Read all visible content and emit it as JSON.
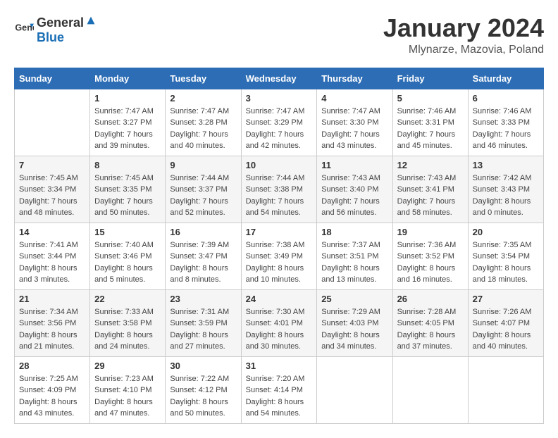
{
  "header": {
    "logo_general": "General",
    "logo_blue": "Blue",
    "title": "January 2024",
    "location": "Mlynarze, Mazovia, Poland"
  },
  "weekdays": [
    "Sunday",
    "Monday",
    "Tuesday",
    "Wednesday",
    "Thursday",
    "Friday",
    "Saturday"
  ],
  "weeks": [
    [
      {
        "day": "",
        "text": ""
      },
      {
        "day": "1",
        "text": "Sunrise: 7:47 AM\nSunset: 3:27 PM\nDaylight: 7 hours\nand 39 minutes."
      },
      {
        "day": "2",
        "text": "Sunrise: 7:47 AM\nSunset: 3:28 PM\nDaylight: 7 hours\nand 40 minutes."
      },
      {
        "day": "3",
        "text": "Sunrise: 7:47 AM\nSunset: 3:29 PM\nDaylight: 7 hours\nand 42 minutes."
      },
      {
        "day": "4",
        "text": "Sunrise: 7:47 AM\nSunset: 3:30 PM\nDaylight: 7 hours\nand 43 minutes."
      },
      {
        "day": "5",
        "text": "Sunrise: 7:46 AM\nSunset: 3:31 PM\nDaylight: 7 hours\nand 45 minutes."
      },
      {
        "day": "6",
        "text": "Sunrise: 7:46 AM\nSunset: 3:33 PM\nDaylight: 7 hours\nand 46 minutes."
      }
    ],
    [
      {
        "day": "7",
        "text": "Sunrise: 7:45 AM\nSunset: 3:34 PM\nDaylight: 7 hours\nand 48 minutes."
      },
      {
        "day": "8",
        "text": "Sunrise: 7:45 AM\nSunset: 3:35 PM\nDaylight: 7 hours\nand 50 minutes."
      },
      {
        "day": "9",
        "text": "Sunrise: 7:44 AM\nSunset: 3:37 PM\nDaylight: 7 hours\nand 52 minutes."
      },
      {
        "day": "10",
        "text": "Sunrise: 7:44 AM\nSunset: 3:38 PM\nDaylight: 7 hours\nand 54 minutes."
      },
      {
        "day": "11",
        "text": "Sunrise: 7:43 AM\nSunset: 3:40 PM\nDaylight: 7 hours\nand 56 minutes."
      },
      {
        "day": "12",
        "text": "Sunrise: 7:43 AM\nSunset: 3:41 PM\nDaylight: 7 hours\nand 58 minutes."
      },
      {
        "day": "13",
        "text": "Sunrise: 7:42 AM\nSunset: 3:43 PM\nDaylight: 8 hours\nand 0 minutes."
      }
    ],
    [
      {
        "day": "14",
        "text": "Sunrise: 7:41 AM\nSunset: 3:44 PM\nDaylight: 8 hours\nand 3 minutes."
      },
      {
        "day": "15",
        "text": "Sunrise: 7:40 AM\nSunset: 3:46 PM\nDaylight: 8 hours\nand 5 minutes."
      },
      {
        "day": "16",
        "text": "Sunrise: 7:39 AM\nSunset: 3:47 PM\nDaylight: 8 hours\nand 8 minutes."
      },
      {
        "day": "17",
        "text": "Sunrise: 7:38 AM\nSunset: 3:49 PM\nDaylight: 8 hours\nand 10 minutes."
      },
      {
        "day": "18",
        "text": "Sunrise: 7:37 AM\nSunset: 3:51 PM\nDaylight: 8 hours\nand 13 minutes."
      },
      {
        "day": "19",
        "text": "Sunrise: 7:36 AM\nSunset: 3:52 PM\nDaylight: 8 hours\nand 16 minutes."
      },
      {
        "day": "20",
        "text": "Sunrise: 7:35 AM\nSunset: 3:54 PM\nDaylight: 8 hours\nand 18 minutes."
      }
    ],
    [
      {
        "day": "21",
        "text": "Sunrise: 7:34 AM\nSunset: 3:56 PM\nDaylight: 8 hours\nand 21 minutes."
      },
      {
        "day": "22",
        "text": "Sunrise: 7:33 AM\nSunset: 3:58 PM\nDaylight: 8 hours\nand 24 minutes."
      },
      {
        "day": "23",
        "text": "Sunrise: 7:31 AM\nSunset: 3:59 PM\nDaylight: 8 hours\nand 27 minutes."
      },
      {
        "day": "24",
        "text": "Sunrise: 7:30 AM\nSunset: 4:01 PM\nDaylight: 8 hours\nand 30 minutes."
      },
      {
        "day": "25",
        "text": "Sunrise: 7:29 AM\nSunset: 4:03 PM\nDaylight: 8 hours\nand 34 minutes."
      },
      {
        "day": "26",
        "text": "Sunrise: 7:28 AM\nSunset: 4:05 PM\nDaylight: 8 hours\nand 37 minutes."
      },
      {
        "day": "27",
        "text": "Sunrise: 7:26 AM\nSunset: 4:07 PM\nDaylight: 8 hours\nand 40 minutes."
      }
    ],
    [
      {
        "day": "28",
        "text": "Sunrise: 7:25 AM\nSunset: 4:09 PM\nDaylight: 8 hours\nand 43 minutes."
      },
      {
        "day": "29",
        "text": "Sunrise: 7:23 AM\nSunset: 4:10 PM\nDaylight: 8 hours\nand 47 minutes."
      },
      {
        "day": "30",
        "text": "Sunrise: 7:22 AM\nSunset: 4:12 PM\nDaylight: 8 hours\nand 50 minutes."
      },
      {
        "day": "31",
        "text": "Sunrise: 7:20 AM\nSunset: 4:14 PM\nDaylight: 8 hours\nand 54 minutes."
      },
      {
        "day": "",
        "text": ""
      },
      {
        "day": "",
        "text": ""
      },
      {
        "day": "",
        "text": ""
      }
    ]
  ]
}
